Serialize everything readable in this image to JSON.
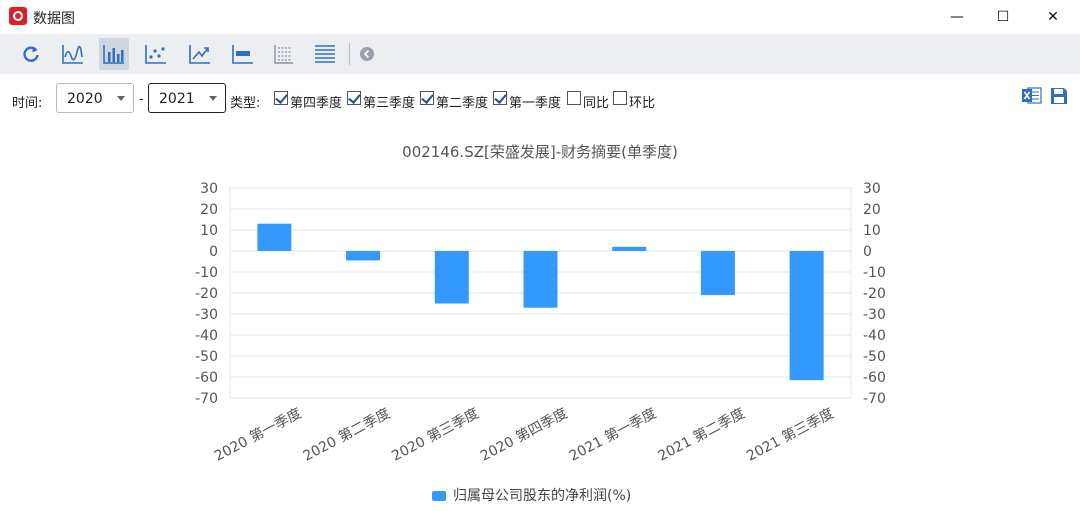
{
  "window": {
    "title": "数据图",
    "minimize": "—",
    "maximize": "☐",
    "close": "✕"
  },
  "toolbar": {
    "items": [
      {
        "name": "refresh-icon"
      },
      {
        "name": "line-chart-icon"
      },
      {
        "name": "bar-chart-icon",
        "active": true
      },
      {
        "name": "scatter-chart-icon"
      },
      {
        "name": "trend-chart-icon"
      },
      {
        "name": "range-chart-icon"
      },
      {
        "name": "table-grid-icon"
      },
      {
        "name": "list-lines-icon"
      },
      {
        "name": "collapse-left-icon"
      }
    ]
  },
  "filters": {
    "time_label": "时间:",
    "start_year": "2020",
    "dash": "-",
    "end_year": "2021",
    "type_label": "类型:",
    "checkboxes": [
      {
        "label": "第四季度",
        "checked": true
      },
      {
        "label": "第三季度",
        "checked": true
      },
      {
        "label": "第二季度",
        "checked": true
      },
      {
        "label": "第一季度",
        "checked": true
      },
      {
        "label": "同比",
        "checked": false
      },
      {
        "label": "环比",
        "checked": false
      }
    ]
  },
  "export": {
    "excel_icon": "excel-icon",
    "save_icon": "save-icon"
  },
  "colors": {
    "bar": "#3399ff",
    "grid": "#e6e6e6",
    "axis": "#999999",
    "text": "#555555"
  },
  "chart_data": {
    "type": "bar",
    "title": "002146.SZ[荣盛发展]-财务摘要(单季度)",
    "categories": [
      "2020 第一季度",
      "2020 第二季度",
      "2020 第三季度",
      "2020 第四季度",
      "2021 第一季度",
      "2021 第二季度",
      "2021 第三季度"
    ],
    "series": [
      {
        "name": "归属母公司股东的净利润(%)",
        "values": [
          13,
          -4.5,
          -25,
          -27,
          2,
          -21,
          -61.5
        ]
      }
    ],
    "ylim": [
      -70,
      30
    ],
    "yticks": [
      30,
      20,
      10,
      0,
      -10,
      -20,
      -30,
      -40,
      -50,
      -60,
      -70
    ],
    "grid": true,
    "legend": "bottom-center"
  }
}
